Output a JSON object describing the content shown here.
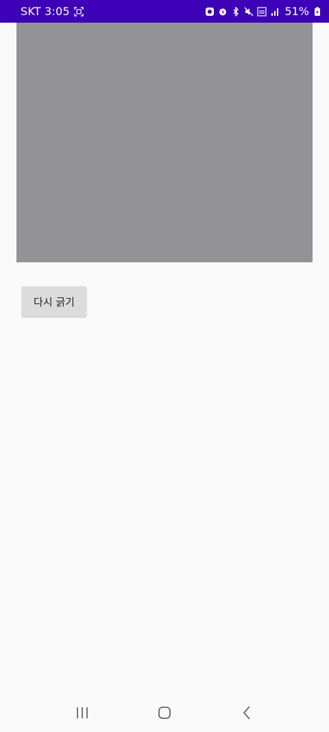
{
  "status_bar": {
    "carrier_time": "SKT 3:05",
    "battery_percent": "51%",
    "background_color": "#3d02b8",
    "icons": [
      "screenshot-icon",
      "app-notification-icon",
      "alarm-icon",
      "bluetooth-icon",
      "mute-icon",
      "wifi-icon",
      "signal-icon",
      "battery-icon"
    ]
  },
  "main": {
    "image_placeholder_color": "#939395",
    "redraw_button_label": "다시 긁기"
  },
  "nav_bar": {
    "icons": [
      "recent-apps-icon",
      "home-icon",
      "back-icon"
    ]
  }
}
